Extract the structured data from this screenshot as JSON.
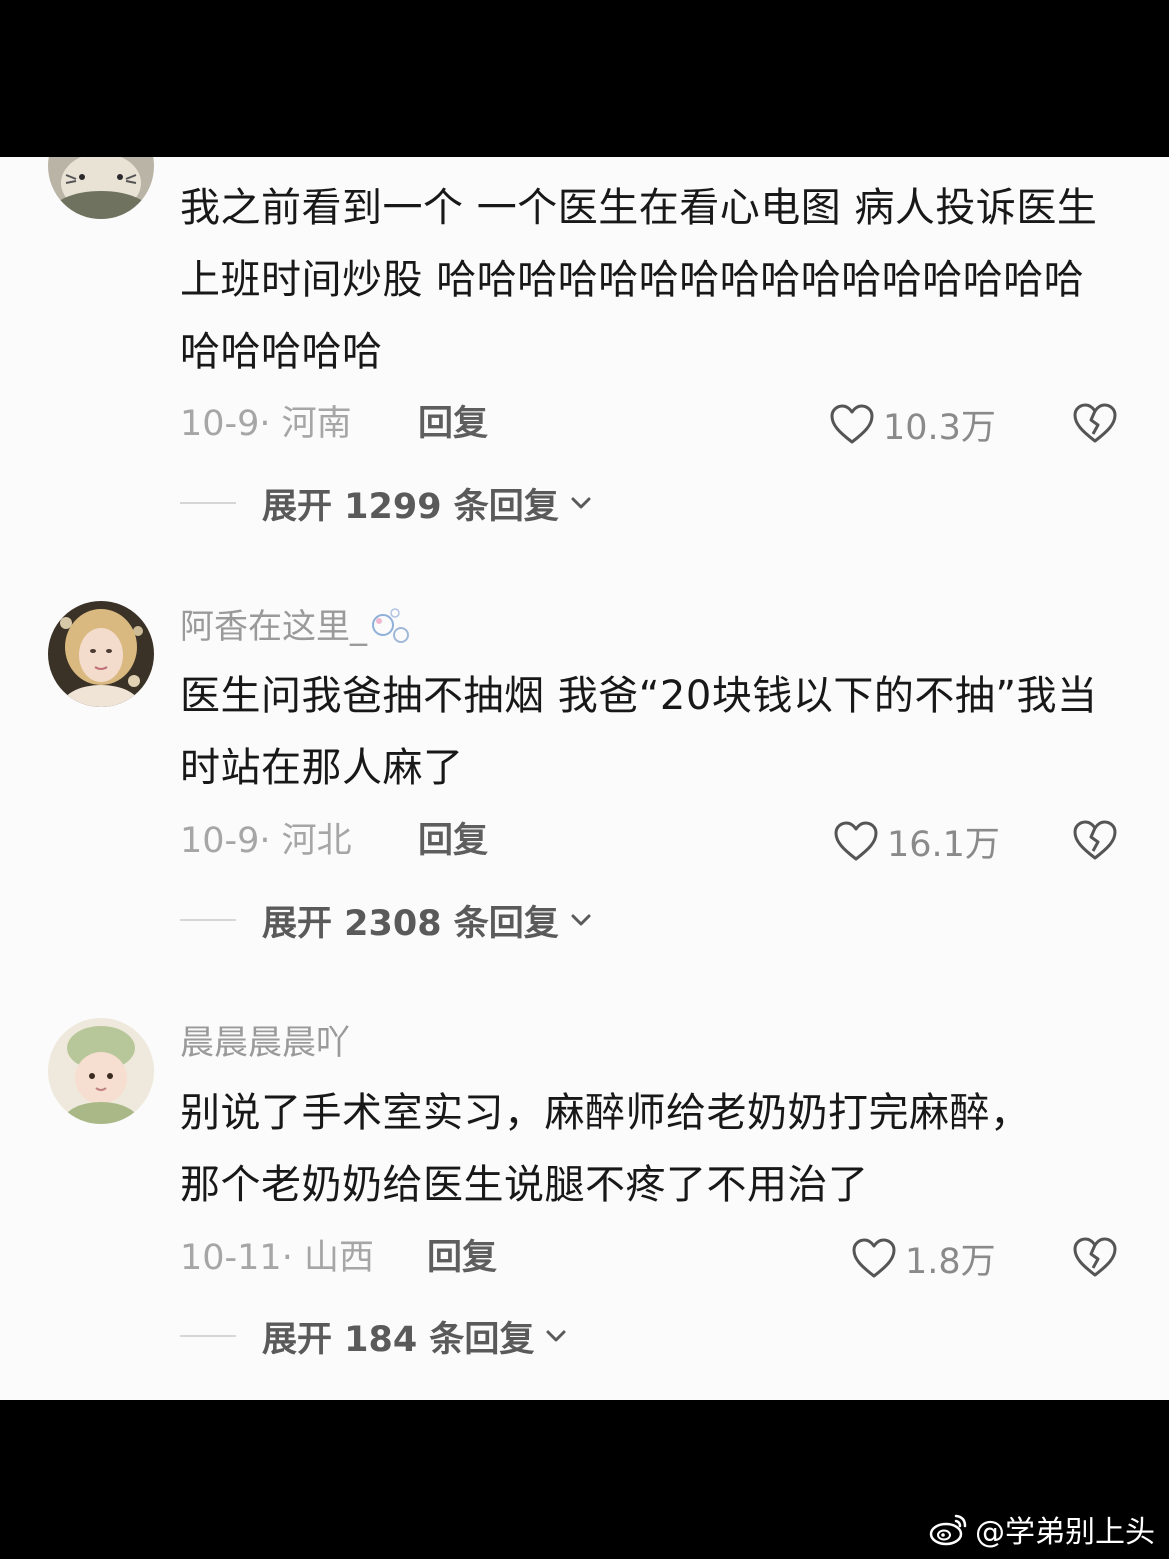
{
  "comments": [
    {
      "username": "",
      "text": "我之前看到一个 一个医生在看心电图 病人投诉医生上班时间炒股 哈哈哈哈哈哈哈哈哈哈哈哈哈哈哈哈哈哈哈哈哈",
      "date_location": "10-9· 河南",
      "reply_label": "回复",
      "likes": "10.3万",
      "expand_label": "展开 1299 条回复",
      "avatar_icon": "partial-avatar-icon"
    },
    {
      "username": "阿香在这里_",
      "text": "医生问我爸抽不抽烟 我爸“20块钱以下的不抽”我当时站在那人麻了",
      "date_location": "10-9· 河北",
      "reply_label": "回复",
      "likes": "16.1万",
      "expand_label": "展开 2308 条回复",
      "avatar_icon": "woman-portrait-avatar-icon"
    },
    {
      "username": "晨晨晨晨吖",
      "text": "别说了手术室实习，麻醉师给老奶奶打完麻醉，那个老奶奶给医生说腿不疼了不用治了",
      "date_location": "10-11· 山西",
      "reply_label": "回复",
      "likes": "1.8万",
      "expand_label": "展开 184 条回复",
      "avatar_icon": "baby-green-hat-avatar-icon"
    }
  ],
  "watermark": {
    "text": "@学弟别上头",
    "icon": "weibo-logo-icon"
  },
  "colors": {
    "panel_background": "#fbfbfb",
    "frame_background": "#000000",
    "body_text": "#181818",
    "muted_text": "#9a9a9a"
  }
}
